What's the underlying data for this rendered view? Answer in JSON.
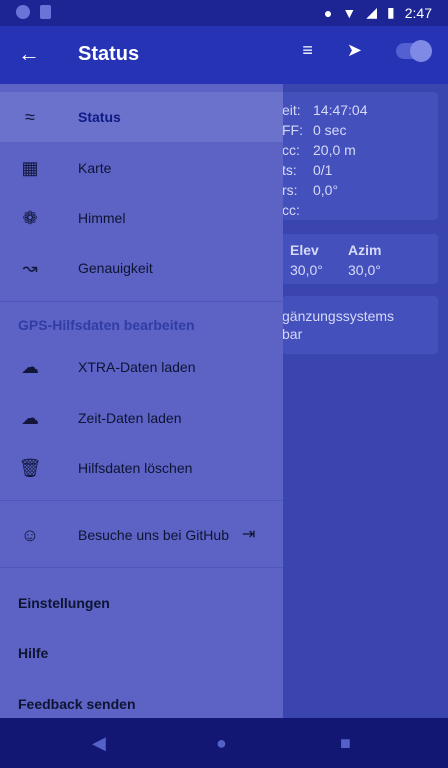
{
  "status_bar": {
    "time": "2:47"
  },
  "app_bar": {
    "title": "Status"
  },
  "status_panel": {
    "rows": [
      {
        "label": "eit:",
        "value": "14:47:04"
      },
      {
        "label": "FF:",
        "value": "0 sec"
      },
      {
        "label": "cc:",
        "value": "20,0 m"
      },
      {
        "label": "ts:",
        "value": "0/1"
      },
      {
        "label": "rs:",
        "value": "0,0°"
      },
      {
        "label": "cc:",
        "value": ""
      }
    ],
    "sat_header": {
      "elev": "Elev",
      "azim": "Azim"
    },
    "sat_values": {
      "elev": "30,0°",
      "azim": "30,0°"
    },
    "note_line1": "gänzungssystems",
    "note_line2": "bar"
  },
  "drawer": {
    "items": [
      {
        "label": "Status",
        "icon": "wifi-icon"
      },
      {
        "label": "Karte",
        "icon": "map-icon"
      },
      {
        "label": "Himmel",
        "icon": "satellite-dish-icon"
      },
      {
        "label": "Genauigkeit",
        "icon": "trending-icon"
      }
    ],
    "subheader": "GPS-Hilfsdaten bearbeiten",
    "aid_items": [
      {
        "label": "XTRA-Daten laden",
        "icon": "cloud-gear-icon"
      },
      {
        "label": "Zeit-Daten laden",
        "icon": "cloud-clock-icon"
      },
      {
        "label": "Hilfsdaten löschen",
        "icon": "trash-icon"
      }
    ],
    "github": {
      "label": "Besuche uns bei GitHub",
      "icon": "github-icon"
    },
    "footer": [
      {
        "label": "Einstellungen"
      },
      {
        "label": "Hilfe"
      },
      {
        "label": "Feedback senden"
      }
    ]
  }
}
